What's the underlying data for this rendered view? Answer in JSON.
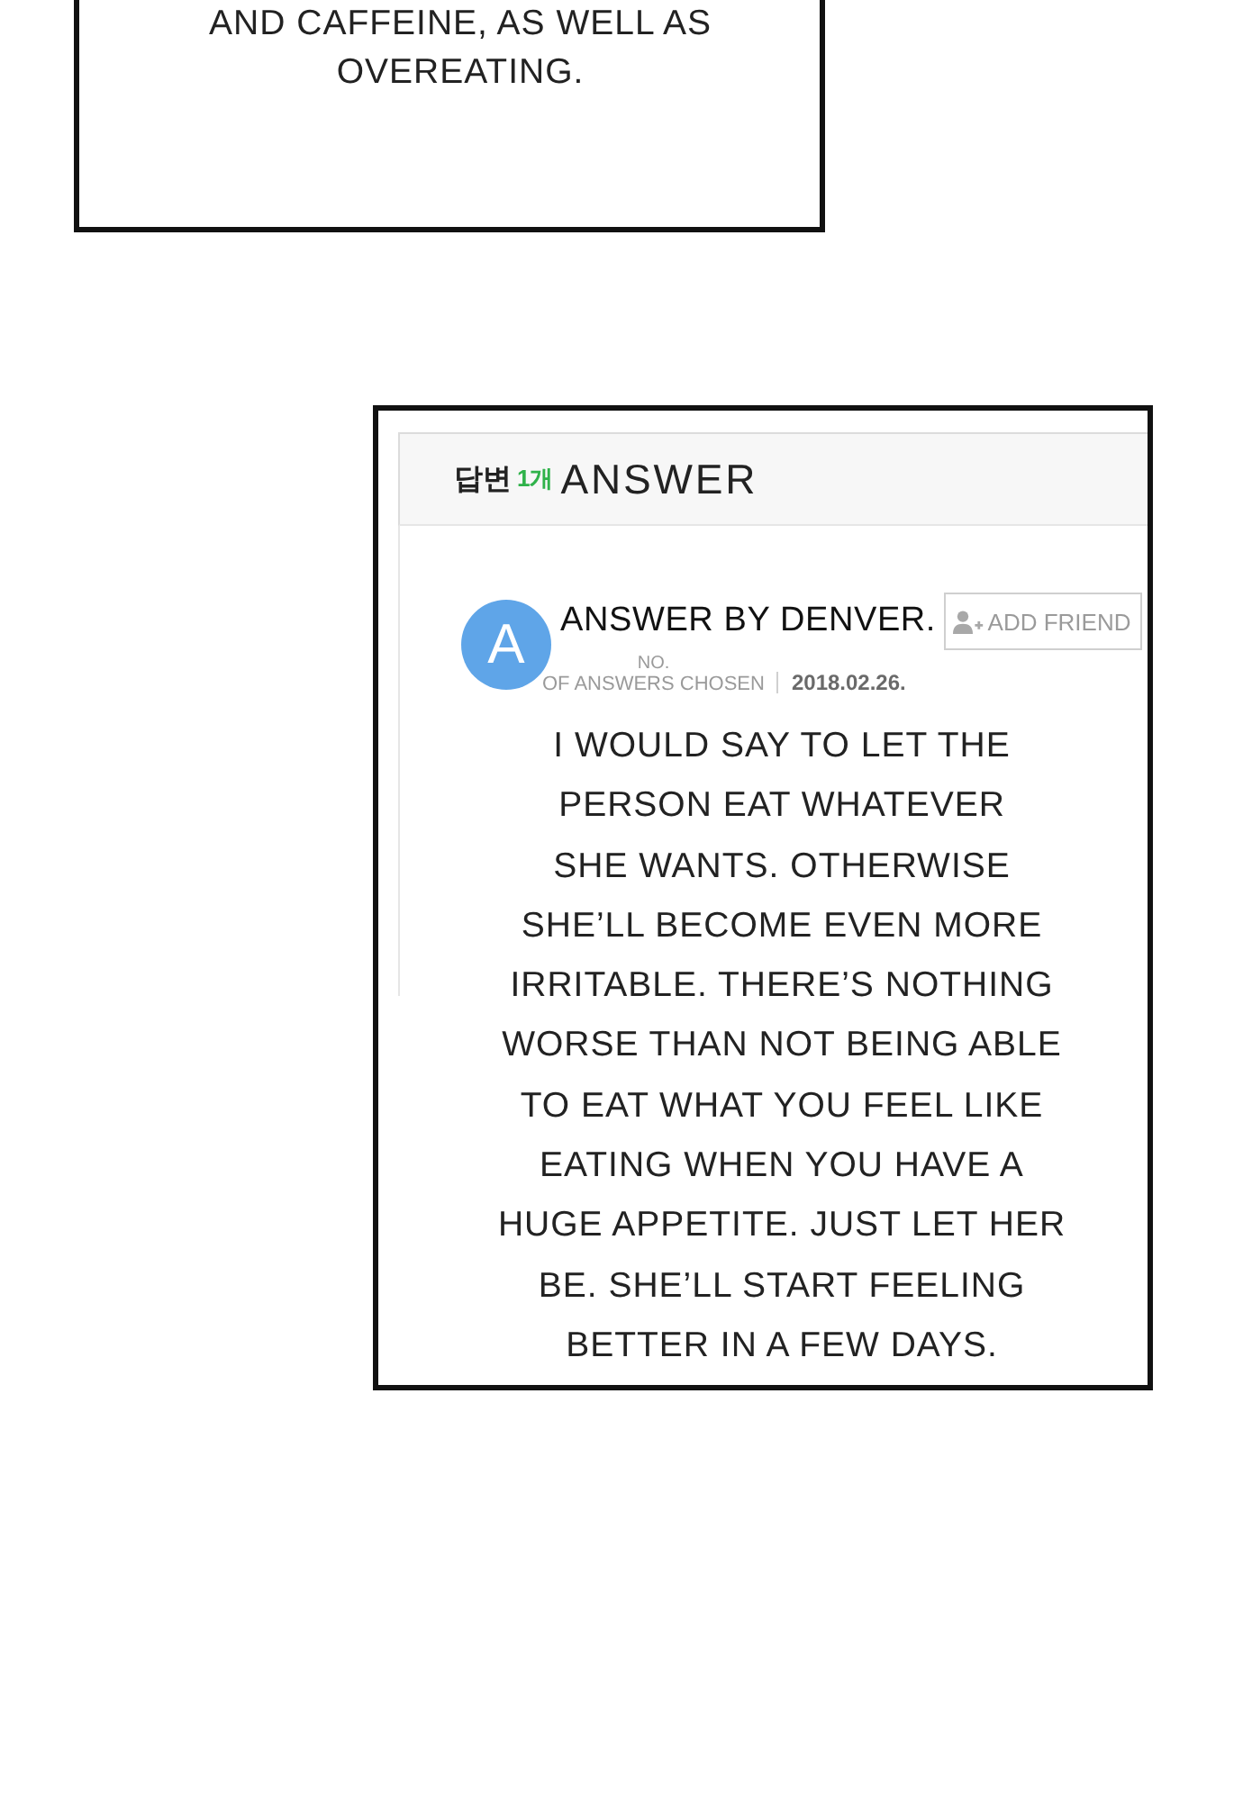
{
  "caption_panel": {
    "text": "AND CAFFEINE, AS WELL AS\nOVEREATING."
  },
  "answer_panel": {
    "header": {
      "label": "답변",
      "count": "1개",
      "title": "ANSWER"
    },
    "answer": {
      "avatar_letter": "A",
      "author": "ANSWER BY DENVER.",
      "add_friend_button": "ADD FRIEND",
      "chosen_label": {
        "top": "NO.",
        "bottom": "OF ANSWERS CHOSEN"
      },
      "date": "2018.02.26.",
      "body": "I WOULD SAY TO LET THE\nPERSON EAT WHATEVER\nSHE WANTS. OTHERWISE\nSHE’LL BECOME EVEN MORE\nIRRITABLE. THERE’S NOTHING\nWORSE THAN NOT BEING ABLE\nTO EAT WHAT YOU FEEL LIKE\nEATING WHEN YOU HAVE A\nHUGE APPETITE. JUST LET HER\nBE. SHE’LL START FEELING\nBETTER IN A FEW DAYS."
    }
  }
}
